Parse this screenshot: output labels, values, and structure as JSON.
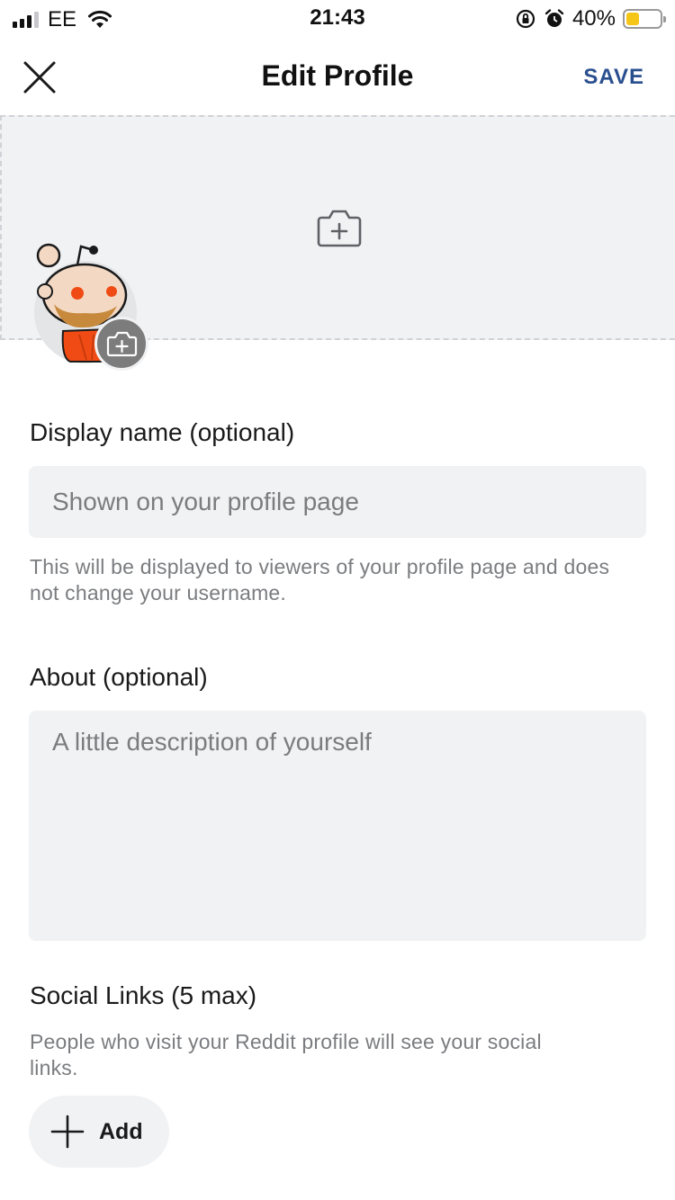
{
  "status_bar": {
    "carrier": "EE",
    "time": "21:43",
    "battery_percent": "40%",
    "battery_level": 0.4,
    "icons": [
      "signal-icon",
      "wifi-icon",
      "rotation-lock-icon",
      "alarm-icon",
      "battery-icon"
    ]
  },
  "nav": {
    "title": "Edit Profile",
    "save_label": "SAVE",
    "close_icon": "close-icon"
  },
  "banner": {
    "camera_icon": "add-photo-icon"
  },
  "avatar": {
    "camera_icon": "add-photo-icon"
  },
  "display_name": {
    "label": "Display name (optional)",
    "placeholder": "Shown on your profile page",
    "value": "",
    "helper": "This will be displayed to viewers of your profile page and does not change your username."
  },
  "about": {
    "label": "About (optional)",
    "placeholder": "A little description of yourself",
    "value": ""
  },
  "social_links": {
    "label": "Social Links (5 max)",
    "helper": "People who visit your Reddit profile will see your social links.",
    "add_label": "Add"
  },
  "colors": {
    "accent": "#2a4f8f",
    "field_bg": "#f1f2f4",
    "muted_text": "#7a7c7f"
  }
}
